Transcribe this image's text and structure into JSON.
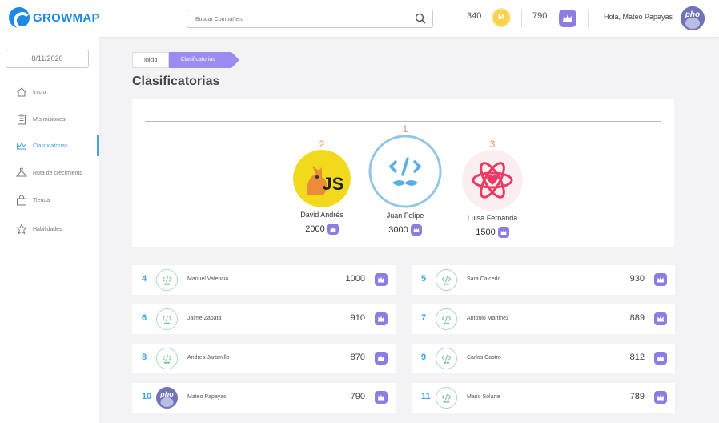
{
  "app": {
    "name": "GROWMAP"
  },
  "header": {
    "search_placeholder": "Buscar Compañero",
    "coins": "340",
    "coin_symbol": "M",
    "crowns": "790",
    "greeting": "Hola, Mateo Papayas",
    "avatar_text": "pho"
  },
  "sidebar": {
    "date": "8/11/2020",
    "items": [
      {
        "label": "Inicio",
        "icon": "home-icon"
      },
      {
        "label": "Mis misiones",
        "icon": "clipboard-icon"
      },
      {
        "label": "Clasificatorias",
        "icon": "crown-icon",
        "active": true
      },
      {
        "label": "Ruta de crecimiento",
        "icon": "hanger-icon"
      },
      {
        "label": "Tienda",
        "icon": "bag-icon"
      },
      {
        "label": "Habilidades",
        "icon": "star-icon"
      }
    ]
  },
  "breadcrumb": {
    "home": "Inicio",
    "current": "Clasificatorias"
  },
  "page_title": "Clasificatorias",
  "podium": [
    {
      "rank": "2",
      "name": "David Andrés",
      "points": "2000",
      "avatar_text": "JS"
    },
    {
      "rank": "1",
      "name": "Juan Felipe",
      "points": "3000"
    },
    {
      "rank": "3",
      "name": "Luisa Fernanda",
      "points": "1500"
    }
  ],
  "ranking": [
    {
      "rank": "4",
      "name": "Manuel Valencia",
      "points": "1000"
    },
    {
      "rank": "5",
      "name": "Sara Caicedo",
      "points": "930"
    },
    {
      "rank": "6",
      "name": "Jaime Zapata",
      "points": "910"
    },
    {
      "rank": "7",
      "name": "Antonio Martinez",
      "points": "889"
    },
    {
      "rank": "8",
      "name": "Andrea Jaramillo",
      "points": "870"
    },
    {
      "rank": "9",
      "name": "Carlos Castro",
      "points": "812"
    },
    {
      "rank": "10",
      "name": "Mateo Papayas",
      "points": "790",
      "avatar_text": "pho"
    },
    {
      "rank": "11",
      "name": "Mario Solarte",
      "points": "789"
    }
  ],
  "colors": {
    "brand": "#1e88e5",
    "accent": "#4aa3df",
    "purple": "#8d7de3",
    "rank_orange": "#f0905a"
  }
}
